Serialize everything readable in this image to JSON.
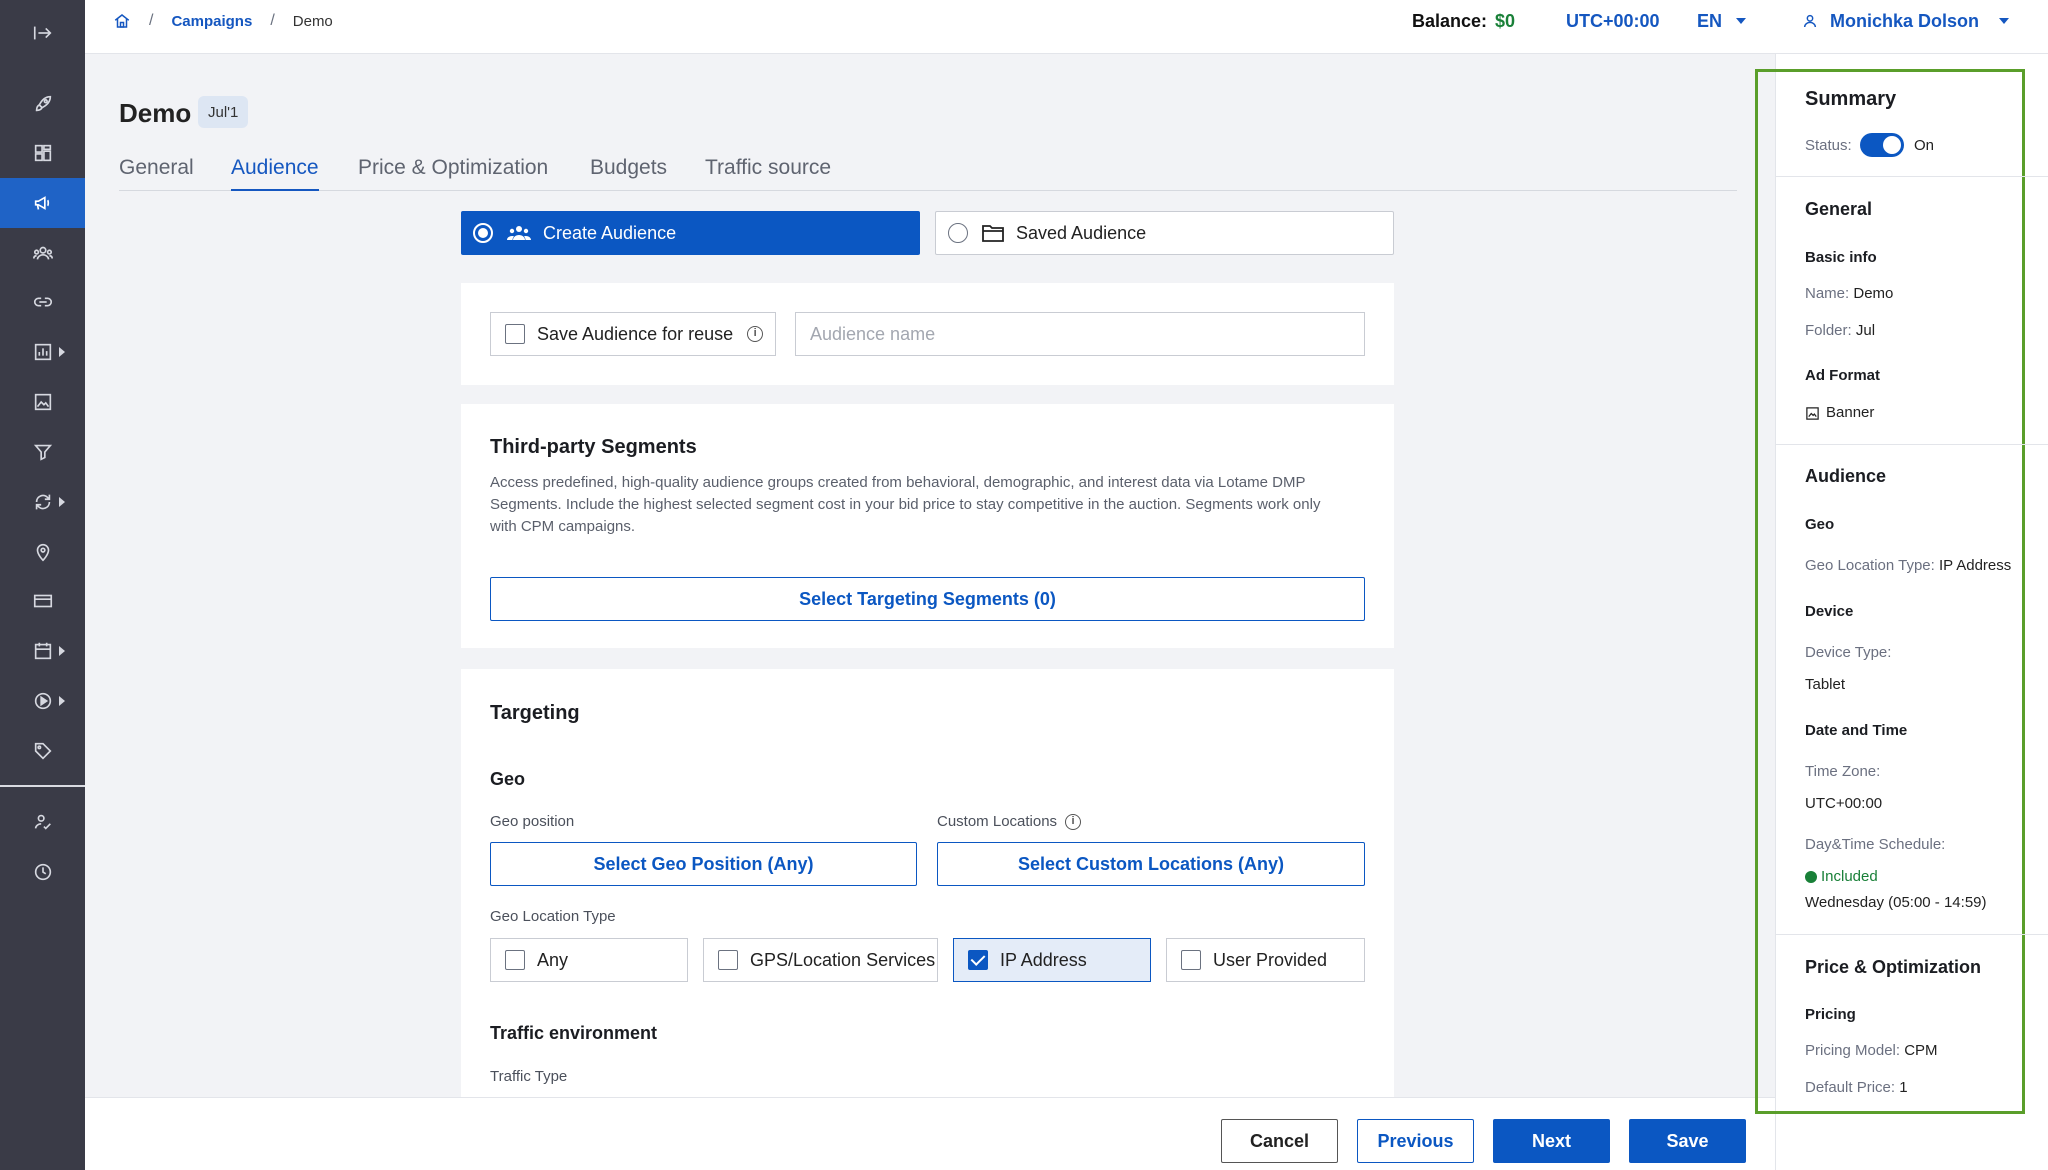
{
  "breadcrumb": {
    "campaigns": "Campaigns",
    "current": "Demo",
    "sep": "/"
  },
  "topbar": {
    "balance_label": "Balance:",
    "balance_value": "$0",
    "timezone": "UTC+00:00",
    "language": "EN",
    "user": "Monichka Dolson"
  },
  "page": {
    "title": "Demo",
    "badge": "Jul'1"
  },
  "tabs": [
    "General",
    "Audience",
    "Price & Optimization",
    "Budgets",
    "Traffic source"
  ],
  "audience_mode": {
    "create": "Create Audience",
    "saved": "Saved Audience"
  },
  "save_audience": {
    "label": "Save Audience for reuse",
    "placeholder": "Audience name"
  },
  "segments": {
    "title": "Third-party Segments",
    "desc_line1": "Access predefined, high-quality audience groups created from behavioral, demographic, and interest data via Lotame DMP",
    "desc_line2": "Segments. Include the highest selected segment cost in your bid price to stay competitive in the auction. Segments work only",
    "desc_line3": "with CPM campaigns.",
    "button": "Select Targeting Segments (0)"
  },
  "targeting": {
    "title": "Targeting",
    "geo_title": "Geo",
    "geo_position_label": "Geo position",
    "geo_position_button": "Select Geo Position (Any)",
    "custom_locations_label": "Custom Locations",
    "custom_locations_button": "Select Custom Locations (Any)",
    "geo_location_type_label": "Geo Location Type",
    "geo_options": [
      {
        "label": "Any",
        "checked": false
      },
      {
        "label": "GPS/Location Services",
        "checked": false
      },
      {
        "label": "IP Address",
        "checked": true
      },
      {
        "label": "User Provided",
        "checked": false
      }
    ],
    "traffic_env_title": "Traffic environment",
    "traffic_type_label": "Traffic Type"
  },
  "footer": {
    "cancel": "Cancel",
    "previous": "Previous",
    "next": "Next",
    "save": "Save"
  },
  "summary": {
    "title": "Summary",
    "status_label": "Status:",
    "status_value": "On",
    "general_title": "General",
    "basic_info": "Basic info",
    "name_label": "Name:",
    "name_value": "Demo",
    "folder_label": "Folder:",
    "folder_value": "Jul",
    "ad_format_title": "Ad Format",
    "ad_format_value": "Banner",
    "audience_title": "Audience",
    "geo_title": "Geo",
    "geo_location_type_label": "Geo Location Type:",
    "geo_location_type_value": "IP Address",
    "device_title": "Device",
    "device_type_label": "Device Type:",
    "device_type_value": "Tablet",
    "date_time_title": "Date and Time",
    "time_zone_label": "Time Zone:",
    "time_zone_value": "UTC+00:00",
    "schedule_label": "Day&Time Schedule:",
    "schedule_status": "Included",
    "schedule_value": "Wednesday (05:00 - 14:59)",
    "price_title": "Price & Optimization",
    "pricing_title": "Pricing",
    "pricing_model_label": "Pricing Model:",
    "pricing_model_value": "CPM",
    "default_price_label": "Default Price:",
    "default_price_value": "1"
  }
}
